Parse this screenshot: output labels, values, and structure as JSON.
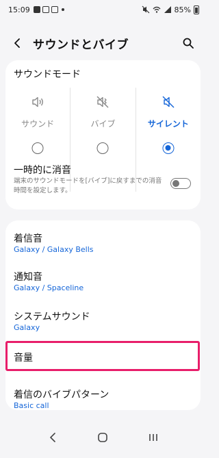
{
  "status_bar": {
    "time": "15:09",
    "battery": "85%"
  },
  "header": {
    "title": "サウンドとバイブ"
  },
  "sound_mode": {
    "section_title": "サウンドモード",
    "modes": [
      {
        "label": "サウンド",
        "icon": "speaker-icon",
        "selected": false
      },
      {
        "label": "バイブ",
        "icon": "vibrate-icon",
        "selected": false
      },
      {
        "label": "サイレント",
        "icon": "mute-icon",
        "selected": true
      }
    ],
    "temporary_mute": {
      "title": "一時的に消音",
      "description": "端末のサウンドモードを[バイブ]に戻すまでの消音時間を設定します。",
      "enabled": false
    }
  },
  "settings": {
    "items": [
      {
        "label": "着信音",
        "value": "Galaxy / Galaxy Bells"
      },
      {
        "label": "通知音",
        "value": "Galaxy / Spaceline"
      },
      {
        "label": "システムサウンド",
        "value": "Galaxy"
      },
      {
        "label": "音量",
        "value": ""
      },
      {
        "label": "着信のバイブパターン",
        "value": "Basic call"
      }
    ]
  },
  "colors": {
    "accent": "#1465d8",
    "highlight": "#e81e6a",
    "background": "#f5f5f7"
  }
}
